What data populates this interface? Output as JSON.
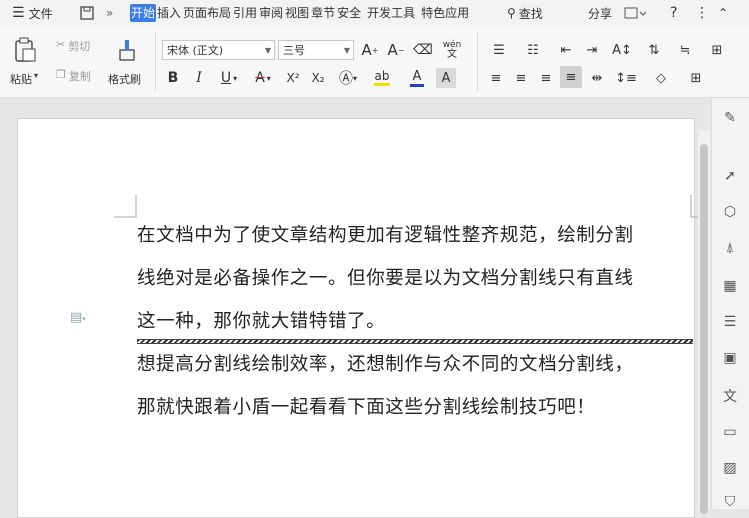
{
  "menu": {
    "file_label": "文件",
    "tabs": [
      "开始",
      "插入",
      "页面布局",
      "引用",
      "审阅",
      "视图",
      "章节",
      "安全",
      "开发工具",
      "特色应用"
    ],
    "search_label": "查找",
    "share_label": "分享",
    "help_label": "?"
  },
  "ribbon": {
    "paste_label": "粘贴",
    "cut_label": "剪切",
    "copy_label": "复制",
    "format_painter_label": "格式刷",
    "font_name": "宋体 (正文)",
    "font_size": "三号",
    "wen_label": "wén",
    "bold": "B",
    "italic": "I",
    "underline": "U",
    "strike": "A",
    "superscript": "X²",
    "subscript": "X₂"
  },
  "document": {
    "lines": [
      "在文档中为了使文章结构更加有逻辑性整齐规范，绘制分割",
      "线绝对是必备操作之一。但你要是以为文档分割线只有直线",
      "这一种，那你就大错特错了。",
      "想提高分割线绘制效率，还想制作与众不同的文档分割线，",
      "那就快跟着小盾一起看看下面这些分割线绘制技巧吧！"
    ]
  },
  "colors": {
    "accent": "#3b7de8",
    "font_color": "#1f3fd0",
    "highlight": "#f5e000",
    "strike_color": "#e03030"
  }
}
